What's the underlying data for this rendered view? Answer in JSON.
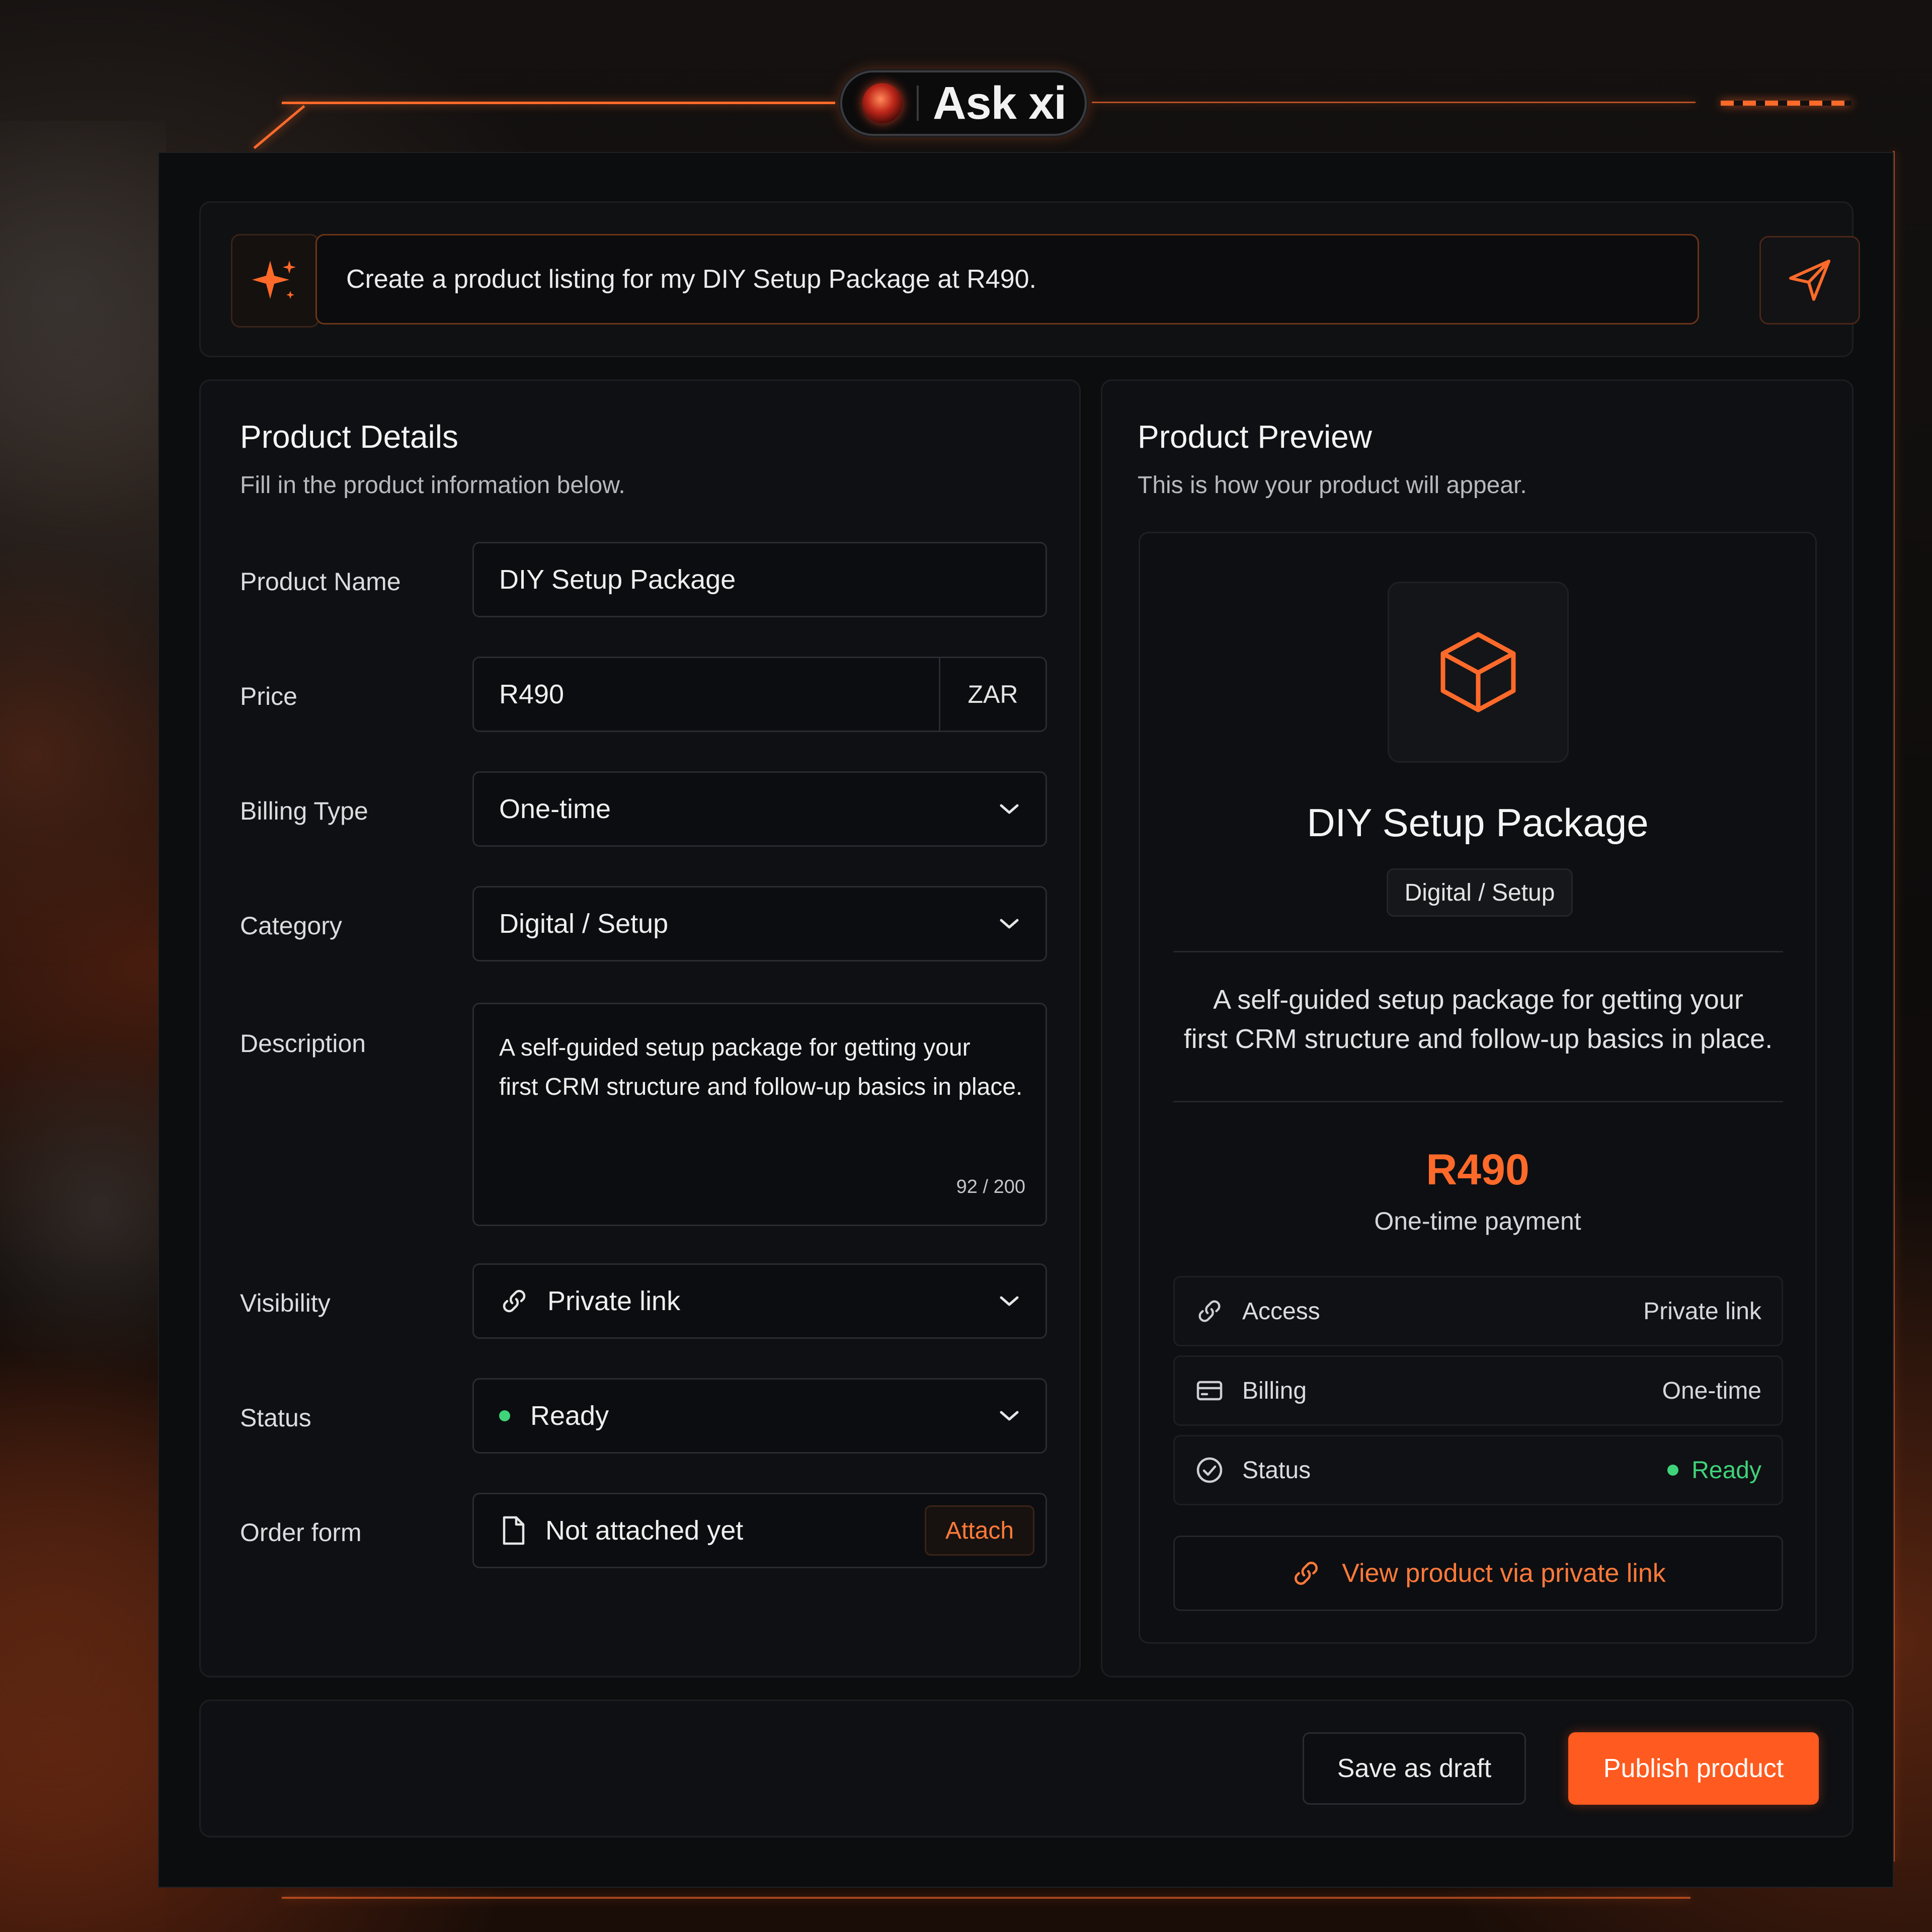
{
  "app": {
    "title": "Ask xi",
    "icon": "orb-avatar-icon"
  },
  "prompt": {
    "text": "Create a product listing for my DIY Setup Package at R490.",
    "sparkle_icon": "sparkle-icon",
    "send_icon": "send-icon"
  },
  "details": {
    "title": "Product Details",
    "subtitle": "Fill in the product information below.",
    "labels": {
      "name": "Product Name",
      "price": "Price",
      "billing": "Billing Type",
      "category": "Category",
      "description": "Description",
      "visibility": "Visibility",
      "status": "Status",
      "order_form": "Order form"
    },
    "values": {
      "name": "DIY Setup Package",
      "price": "R490",
      "currency": "ZAR",
      "billing": "One-time",
      "category": "Digital / Setup",
      "description_line1": "A self-guided setup package for getting your",
      "description_line2": "first CRM structure and follow-up basics in place.",
      "description_count": "92 / 200",
      "visibility": "Private link",
      "status": "Ready",
      "order_form": "Not attached yet",
      "attach": "Attach"
    }
  },
  "preview": {
    "title": "Product Preview",
    "subtitle": "This is how your product will appear.",
    "name": "DIY Setup Package",
    "category": "Digital / Setup",
    "description_line1": "A self-guided setup package for getting your",
    "description_line2": "first CRM structure and follow-up basics in place.",
    "price": "R490",
    "payment": "One-time payment",
    "rows": [
      {
        "label": "Access",
        "value": "Private link",
        "icon": "link-icon"
      },
      {
        "label": "Billing",
        "value": "One-time",
        "icon": "card-icon"
      },
      {
        "label": "Status",
        "value": "Ready",
        "icon": "check-circle-icon"
      }
    ],
    "link_label": "View product via private link"
  },
  "footer": {
    "save_draft": "Save as draft",
    "publish": "Publish product"
  },
  "colors": {
    "accent": "#ff6a2a",
    "publish": "#ff5a1f",
    "status_green": "#3fd37a",
    "panel_bg": "#0c0d0f"
  }
}
